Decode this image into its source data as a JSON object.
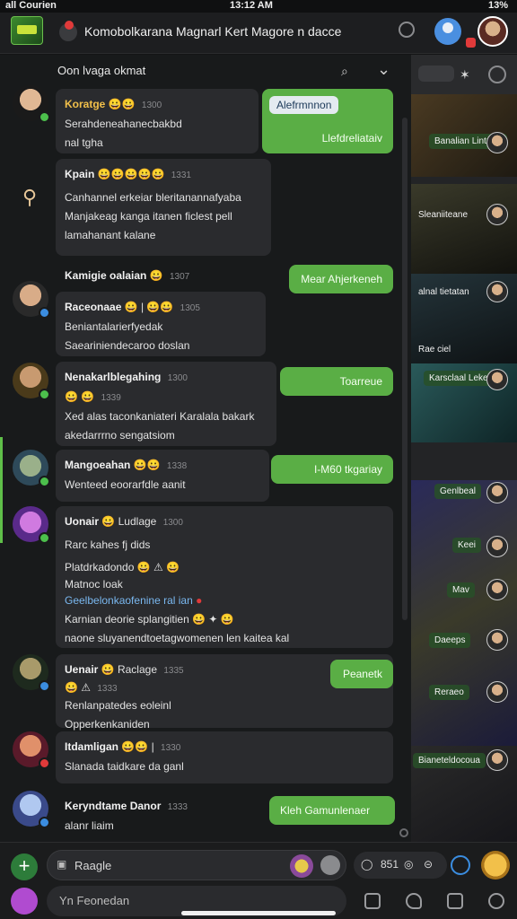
{
  "status_bar": {
    "carrier": "all Courien",
    "time": "13:12 AM",
    "battery": "13%"
  },
  "header": {
    "title": "Komobolkarana Magnarl Kert Magore n dacce"
  },
  "thread": {
    "title": "Oon lvaga okmat",
    "messages": [
      {
        "name": "Koratge",
        "time": "1300",
        "lines": [
          "Serahdeneahanecbakbd",
          "nal tgha"
        ],
        "reply": "Llefdreliataiv",
        "chip": "Alefrmnnon"
      },
      {
        "name": "Kpain",
        "time": "1331",
        "lines": [
          "Canhannel erkeiar bleritanannafyaba",
          "Manjakeag kanga itanen ficlest pell",
          "lamahanant kalane"
        ]
      },
      {
        "name": "Kamigie oalaian",
        "time": "1307",
        "reply": "Mear Ahjerkeneh"
      },
      {
        "name": "Raceonaae",
        "time": "1305",
        "lines": [
          "Beniantalarierfyedak",
          "Saeariniendecaroo doslan"
        ]
      },
      {
        "name": "Nenakarlblegahing",
        "time": "1300",
        "sub": "1339",
        "lines": [
          "Xed alas taconkaniateri Karalala bakark",
          "akedarrrno sengatsiom"
        ],
        "reply": "Toarreue"
      },
      {
        "name": "Mangoeahan",
        "time": "1338",
        "lines": [
          "Wenteed eoorarfdle aanit"
        ],
        "reply": "I-M60 tkgariay"
      },
      {
        "name": "Uonair",
        "time": "1300",
        "tag": "Ludlage",
        "lines": [
          "Rarc kahes fj dids",
          "Platdrkadondo",
          "Matnoc loak",
          "Geelbelonkaofenine ral ian",
          "Karnian deorie splangitien",
          "naone sluyanendtoetagwomenen len kaitea kal"
        ],
        "link": "Geelbelonkaofenine"
      },
      {
        "name": "Uenair",
        "time": "1335",
        "tag": "Raclage",
        "sub": "1333",
        "lines": [
          "Renlanpatedes eoleinl",
          "Opperkenkaniden"
        ],
        "reply": "Peanetk"
      },
      {
        "name": "Itdamligan",
        "time": "1330",
        "lines": [
          "Slanada taidkare da ganl"
        ]
      },
      {
        "name": "Keryndtame Danor",
        "time": "1333",
        "lines": [
          "alanr liaim"
        ],
        "reply": "Kleh Gamunlenaer"
      }
    ]
  },
  "right_column": {
    "labels": [
      "Banalian Lintubo",
      "Sleaniiteane",
      "alnal tietatan",
      "Rae ciel",
      "Karsclaal Leke",
      "Genlbeal",
      "Keei",
      "Mav",
      "Daeeps",
      "Reraeo",
      "Bianeteldocoua"
    ]
  },
  "composer": {
    "placeholder": "Raagle",
    "tools_label": "851",
    "placeholder2": "Yn Feonedan"
  },
  "colors": {
    "accent_green": "#5aae45",
    "bubble": "#2a2b2e",
    "background": "#181a1b"
  }
}
